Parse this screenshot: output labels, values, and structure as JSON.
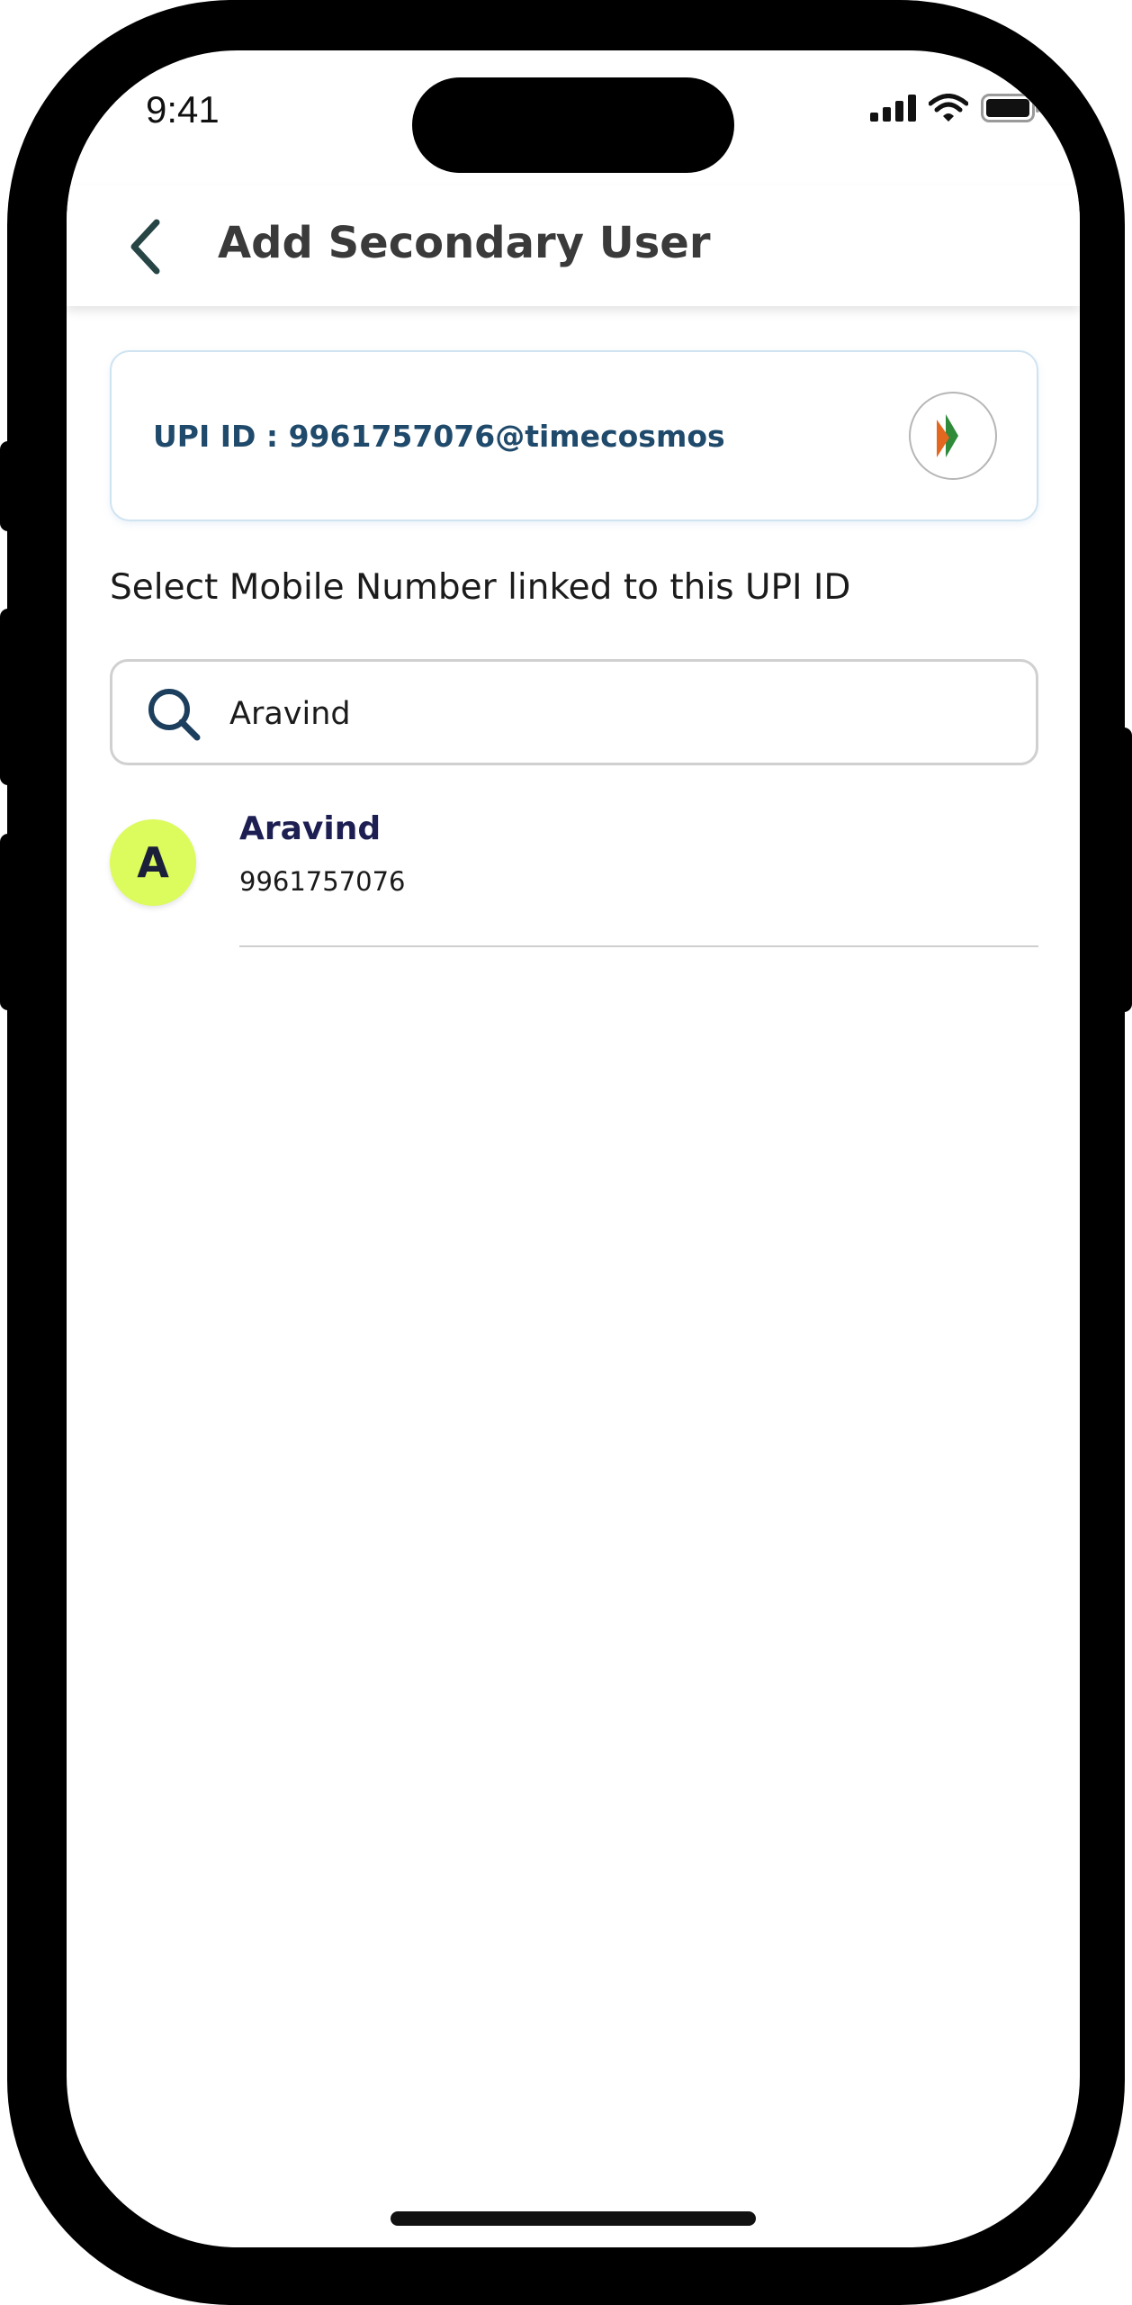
{
  "status_bar": {
    "time": "9:41",
    "icons": [
      "signal-icon",
      "wifi-icon",
      "battery-icon"
    ]
  },
  "header": {
    "title": "Add Secondary User",
    "back_icon": "chevron-left-icon"
  },
  "upi_card": {
    "label": "UPI ID : 9961757076@timecosmos",
    "logo_icon": "bhim-logo-icon"
  },
  "section_label": "Select Mobile Number linked to this UPI ID",
  "search": {
    "value": "Aravind",
    "icon": "search-icon"
  },
  "contacts": [
    {
      "initial": "A",
      "name": "Aravind",
      "phone": "9961757076"
    }
  ],
  "colors": {
    "accent_text": "#1f4a6b",
    "avatar_bg": "#dcfb5c",
    "name_text": "#1d1f52",
    "card_border": "#cfe3f1"
  }
}
